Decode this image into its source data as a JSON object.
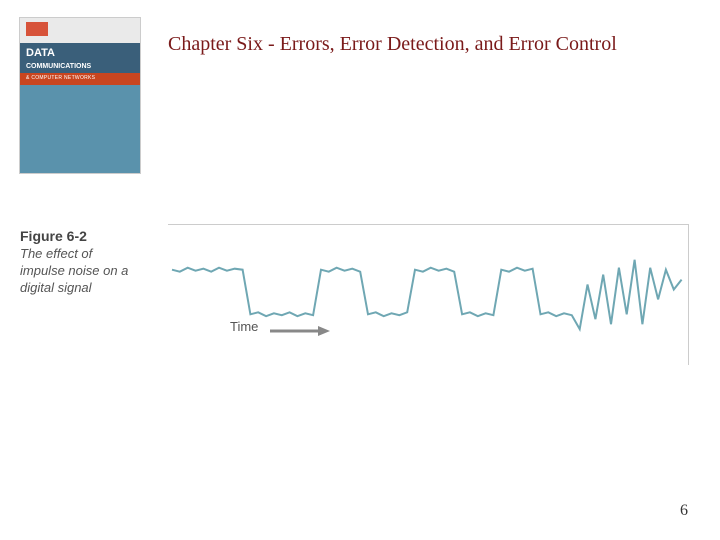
{
  "book": {
    "title_line1": "DATA",
    "title_line2": "COMMUNICATIONS",
    "subtitle": "& COMPUTER NETWORKS"
  },
  "chapter_title": "Chapter Six - Errors, Error Detection, and Error Control",
  "figure": {
    "number": "Figure 6-2",
    "description": "The effect of impulse noise on a digital signal",
    "time_label": "Time"
  },
  "page_number": "6",
  "colors": {
    "title": "#7a1a1a",
    "signal": "#6fa7b3",
    "band": "#3a5f7a",
    "accent": "#c9451f"
  },
  "chart_data": {
    "type": "line",
    "title": "The effect of impulse noise on a digital signal",
    "xlabel": "Time",
    "ylabel": "",
    "ylim": [
      0,
      100
    ],
    "x": [
      0,
      4,
      8,
      12,
      16,
      20,
      24,
      28,
      32,
      36,
      40,
      44,
      48,
      52,
      56,
      60,
      64,
      68,
      72,
      76,
      80,
      84,
      88,
      92,
      96,
      100,
      104,
      108,
      112,
      116,
      120,
      124,
      128,
      132,
      136,
      140,
      144,
      148,
      152,
      156,
      160,
      164,
      168,
      172,
      176,
      180,
      184,
      188,
      192,
      196,
      200,
      204,
      208,
      212,
      216,
      220,
      224,
      228,
      232,
      236,
      240,
      244,
      248,
      252,
      256,
      260
    ],
    "values": [
      70,
      68,
      72,
      69,
      71,
      68,
      72,
      69,
      71,
      70,
      25,
      27,
      23,
      26,
      24,
      27,
      23,
      26,
      24,
      70,
      68,
      72,
      69,
      71,
      68,
      25,
      27,
      23,
      26,
      24,
      27,
      70,
      68,
      72,
      69,
      71,
      68,
      25,
      27,
      23,
      26,
      24,
      70,
      68,
      72,
      69,
      71,
      25,
      27,
      23,
      26,
      24,
      10,
      55,
      20,
      65,
      15,
      72,
      25,
      80,
      15,
      72,
      40,
      70,
      50,
      60
    ]
  }
}
